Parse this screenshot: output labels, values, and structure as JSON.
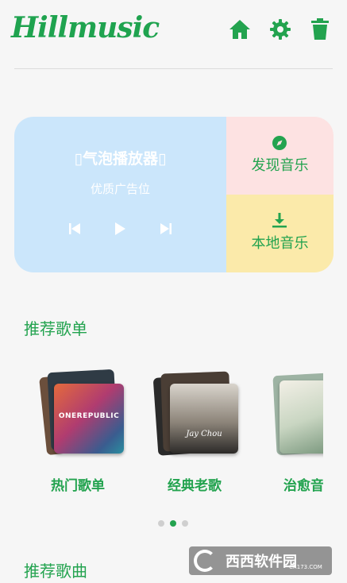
{
  "header": {
    "logo": "Hillmusic",
    "icons": [
      "home-icon",
      "settings-icon",
      "delete-icon"
    ]
  },
  "player": {
    "title": "▯气泡播放器▯",
    "subtitle": "优质广告位",
    "controls": [
      "previous-icon",
      "play-icon",
      "next-icon"
    ]
  },
  "tiles": {
    "discover": "发现音乐",
    "local": "本地音乐"
  },
  "sections": {
    "playlists": "推荐歌单",
    "songs": "推荐歌曲"
  },
  "playlists": [
    {
      "name": "热门歌单",
      "cover_text": "ONEREPUBLIC"
    },
    {
      "name": "经典老歌",
      "cover_text": "Jay Chou"
    },
    {
      "name": "治愈音"
    }
  ],
  "carousel": {
    "active_index": 1,
    "count": 3
  },
  "watermark": {
    "text": "西西软件园",
    "url": "CR173.COM"
  },
  "colors": {
    "accent": "#23a34f",
    "player_bg": "#cbe6fb",
    "discover_bg": "#fde2e2",
    "local_bg": "#fbeaaa"
  }
}
